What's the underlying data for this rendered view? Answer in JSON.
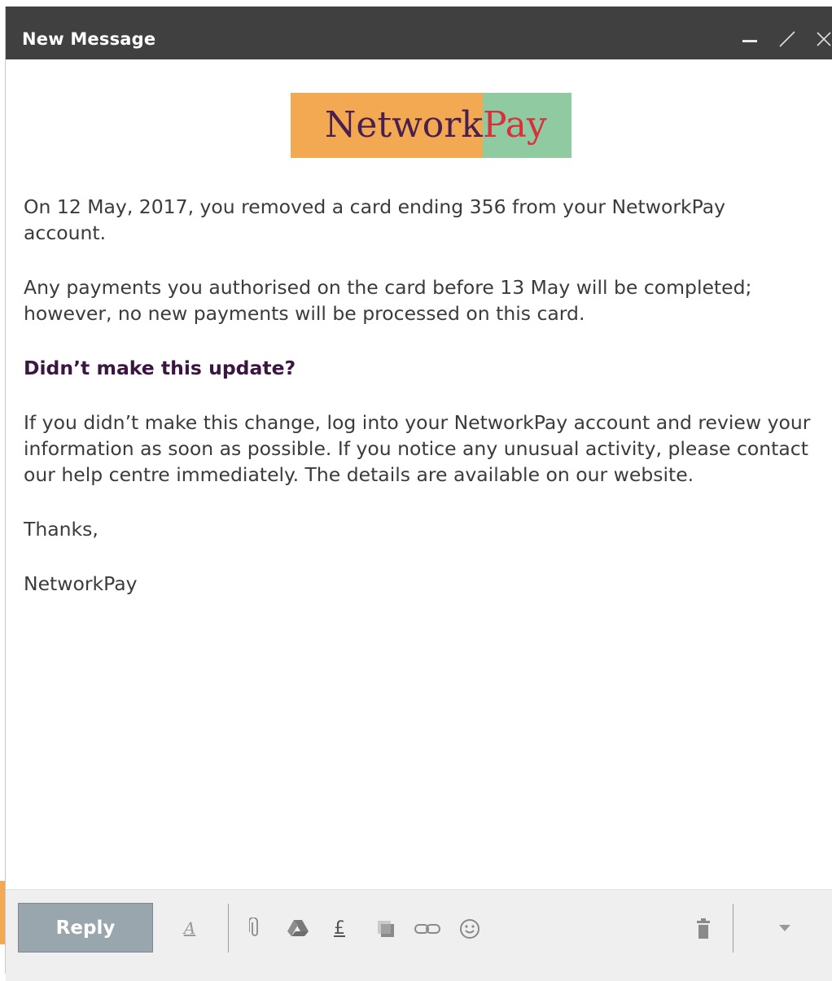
{
  "window": {
    "title": "New Message",
    "controls": [
      "minimize-icon",
      "expand-icon",
      "close-icon"
    ]
  },
  "logo": {
    "part1": "Network",
    "part2": "Pay"
  },
  "message": {
    "p1": "On 12 May, 2017, you removed a card ending 356 from your NetworkPay account.",
    "p2": "Any payments you authorised on the card before 13 May will be completed; however, no new payments will be processed on this card.",
    "heading": "Didn’t make this update?",
    "p3": "If you didn’t make this change, log into your NetworkPay account and review your information as soon as possible. If you notice any unusual activity, please contact our help centre immediately. The details are available on our website.",
    "closing": "Thanks,",
    "signature": "NetworkPay"
  },
  "toolbar": {
    "reply_label": "Reply",
    "format_icon_text": "A",
    "currency_icon_text": "£",
    "icons": [
      "format-text-icon",
      "attach-icon",
      "drive-icon",
      "currency-icon",
      "photo-icon",
      "link-icon",
      "emoji-icon",
      "trash-icon",
      "more-options-icon"
    ]
  },
  "colors": {
    "titlebar": "#404040",
    "logo_orange": "#f3a852",
    "logo_green": "#8fcaa0",
    "logo_purple": "#4a1f4d",
    "logo_red": "#d9303b",
    "reply_button": "#9aa6ad",
    "heading": "#3a1640"
  }
}
